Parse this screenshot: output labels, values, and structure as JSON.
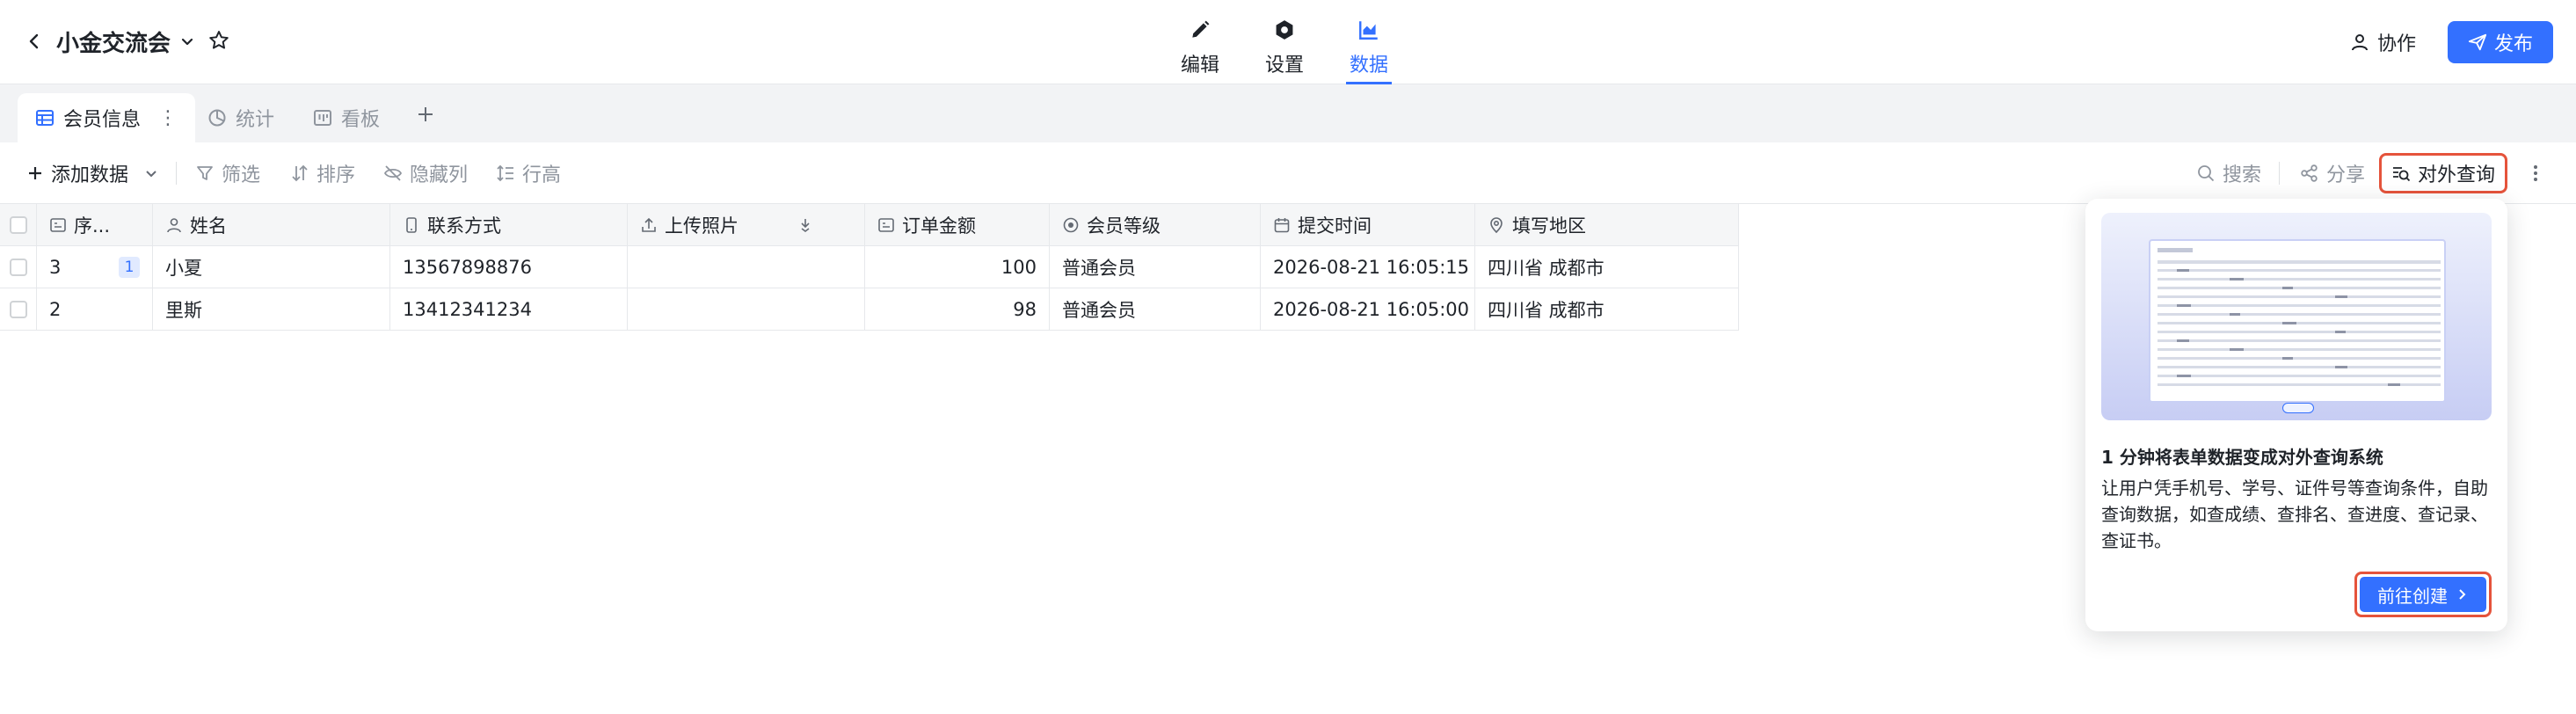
{
  "header": {
    "title": "小金交流会",
    "modes": [
      {
        "label": "编辑",
        "icon": "pencil-icon"
      },
      {
        "label": "设置",
        "icon": "gear-icon"
      },
      {
        "label": "数据",
        "icon": "chart-icon"
      }
    ],
    "collab_label": "协作",
    "publish_label": "发布"
  },
  "views": [
    {
      "label": "会员信息",
      "icon": "table-icon",
      "active": true
    },
    {
      "label": "统计",
      "icon": "pie-chart-icon"
    },
    {
      "label": "看板",
      "icon": "kanban-icon"
    }
  ],
  "toolbar": {
    "add_data": "添加数据",
    "filter": "筛选",
    "sort": "排序",
    "hide_columns": "隐藏列",
    "row_height": "行高",
    "search": "搜索",
    "share": "分享",
    "external_query": "对外查询"
  },
  "table": {
    "columns": [
      "序...",
      "姓名",
      "联系方式",
      "上传照片",
      "订单金额",
      "会员等级",
      "提交时间",
      "填写地区"
    ],
    "rows": [
      {
        "seq": "3",
        "badge": "1",
        "name": "小夏",
        "phone": "13567898876",
        "photo": "",
        "amount": "100",
        "level": "普通会员",
        "time": "2026-08-21 16:05:15",
        "region": "四川省 成都市"
      },
      {
        "seq": "2",
        "badge": "",
        "name": "里斯",
        "phone": "13412341234",
        "photo": "",
        "amount": "98",
        "level": "普通会员",
        "time": "2026-08-21 16:05:00",
        "region": "四川省 成都市"
      }
    ]
  },
  "popup": {
    "title": "1 分钟将表单数据变成对外查询系统",
    "description": "让用户凭手机号、学号、证件号等查询条件，自助查询数据，如查成绩、查排名、查进度、查记录、查证书。",
    "button_label": "前往创建"
  },
  "colors": {
    "accent": "#3370ff",
    "highlight": "#e5533b"
  }
}
